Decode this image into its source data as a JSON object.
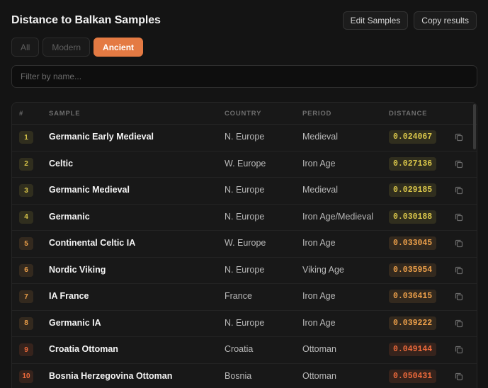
{
  "header": {
    "title": "Distance to Balkan Samples",
    "edit_label": "Edit Samples",
    "copy_label": "Copy results"
  },
  "filters": {
    "all": "All",
    "modern": "Modern",
    "ancient": "Ancient",
    "active": "ancient"
  },
  "search": {
    "placeholder": "Filter by name...",
    "value": ""
  },
  "table": {
    "columns": {
      "rank": "#",
      "sample": "SAMPLE",
      "country": "COUNTRY",
      "period": "PERIOD",
      "distance": "DISTANCE"
    },
    "rows": [
      {
        "rank": "1",
        "sample": "Germanic Early Medieval",
        "country": "N. Europe",
        "period": "Medieval",
        "distance": "0.024067"
      },
      {
        "rank": "2",
        "sample": "Celtic",
        "country": "W. Europe",
        "period": "Iron Age",
        "distance": "0.027136"
      },
      {
        "rank": "3",
        "sample": "Germanic Medieval",
        "country": "N. Europe",
        "period": "Medieval",
        "distance": "0.029185"
      },
      {
        "rank": "4",
        "sample": "Germanic",
        "country": "N. Europe",
        "period": "Iron Age/Medieval",
        "distance": "0.030188"
      },
      {
        "rank": "5",
        "sample": "Continental Celtic IA",
        "country": "W. Europe",
        "period": "Iron Age",
        "distance": "0.033045"
      },
      {
        "rank": "6",
        "sample": "Nordic Viking",
        "country": "N. Europe",
        "period": "Viking Age",
        "distance": "0.035954"
      },
      {
        "rank": "7",
        "sample": "IA France",
        "country": "France",
        "period": "Iron Age",
        "distance": "0.036415"
      },
      {
        "rank": "8",
        "sample": "Germanic IA",
        "country": "N. Europe",
        "period": "Iron Age",
        "distance": "0.039222"
      },
      {
        "rank": "9",
        "sample": "Croatia Ottoman",
        "country": "Croatia",
        "period": "Ottoman",
        "distance": "0.049144"
      },
      {
        "rank": "10",
        "sample": "Bosnia Herzegovina Ottoman",
        "country": "Bosnia",
        "period": "Ottoman",
        "distance": "0.050431"
      }
    ]
  },
  "icons": {
    "copy": "copy-icon"
  },
  "colors": {
    "accent": "#e47a43",
    "distance_near": "#d9c64a",
    "distance_mid": "#eda04a",
    "distance_far": "#ee6a3b"
  }
}
